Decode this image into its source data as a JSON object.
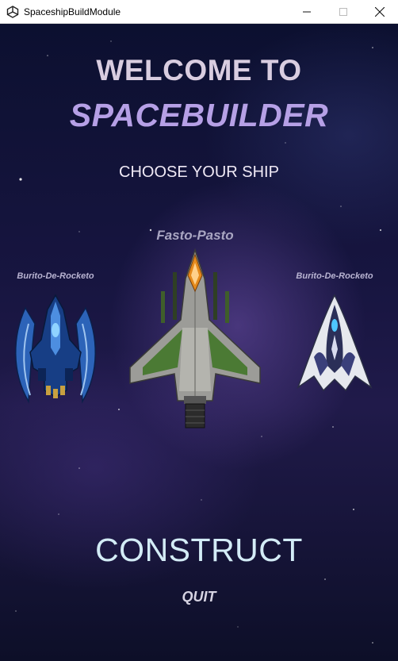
{
  "window": {
    "title": "SpaceshipBuildModule",
    "icon": "unity-icon",
    "controls": {
      "minimize": "minimize-icon",
      "maximize": "maximize-icon",
      "close": "close-icon"
    }
  },
  "menu": {
    "heading_line1": "WELCOME TO",
    "heading_line2": "SPACEBUILDER",
    "subheading": "CHOOSE YOUR SHIP",
    "ships": {
      "left": {
        "name": "Burito-De-Rocketo"
      },
      "center": {
        "name": "Fasto-Pasto"
      },
      "right": {
        "name": "Burito-De-Rocketo"
      }
    },
    "construct_label": "CONSTRUCT",
    "quit_label": "QUIT"
  },
  "colors": {
    "heading1": "#d9cde0",
    "heading2": "#b6a0e6",
    "construct": "#d3ecf6",
    "background": "#171540"
  }
}
